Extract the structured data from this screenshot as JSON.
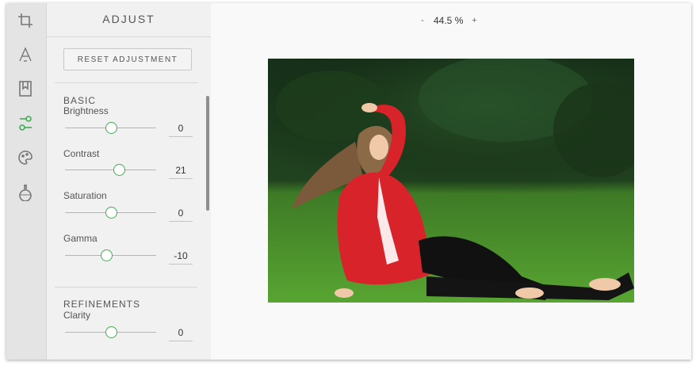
{
  "toolbar": {
    "items": [
      {
        "name": "crop-icon",
        "active": false
      },
      {
        "name": "text-icon",
        "active": false
      },
      {
        "name": "bookmark-icon",
        "active": false
      },
      {
        "name": "adjust-icon",
        "active": true
      },
      {
        "name": "palette-icon",
        "active": false
      },
      {
        "name": "flask-icon",
        "active": false
      }
    ]
  },
  "panel": {
    "title": "ADJUST",
    "reset_label": "RESET ADJUSTMENT",
    "basic": {
      "title": "BASIC",
      "controls": [
        {
          "label": "Brightness",
          "value": "0"
        },
        {
          "label": "Contrast",
          "value": "21"
        },
        {
          "label": "Saturation",
          "value": "0"
        },
        {
          "label": "Gamma",
          "value": "-10"
        }
      ]
    },
    "refinements": {
      "title": "REFINEMENTS",
      "controls": [
        {
          "label": "Clarity",
          "value": "0"
        }
      ]
    }
  },
  "canvas": {
    "zoom_minus": "-",
    "zoom_value": "44.5 %",
    "zoom_plus": "+"
  },
  "colors": {
    "accent": "#3cae4f",
    "rail": "#e4e4e4",
    "panel": "#f1f1f1",
    "jacket": "#d8232a",
    "grass": "#4f9a2c"
  }
}
